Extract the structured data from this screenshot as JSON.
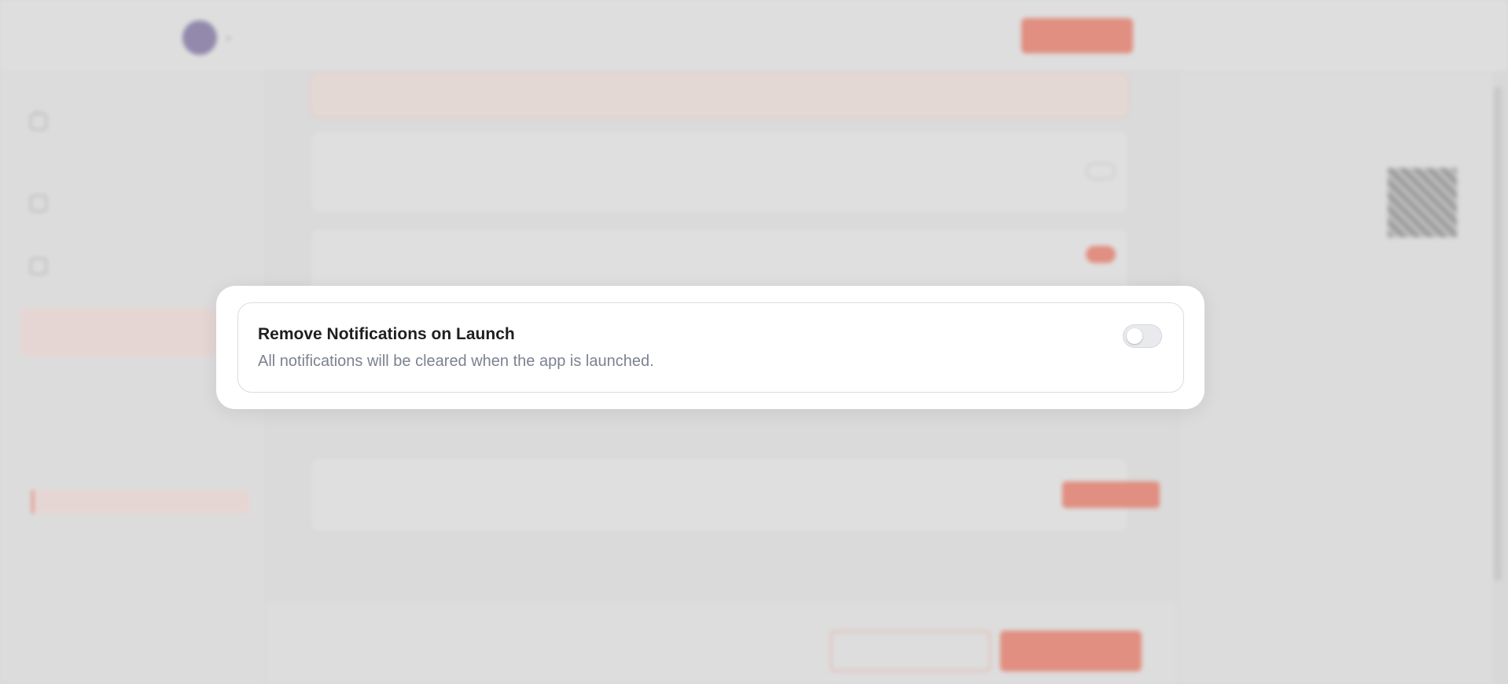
{
  "colors": {
    "accent": "#e8543a",
    "modal_bg": "#ffffff",
    "toggle_off_bg": "#e9eaee",
    "description_text": "#7b8290",
    "backdrop": "#d8d8d8"
  },
  "modal": {
    "setting": {
      "title": "Remove Notifications on Launch",
      "description": "All notifications will be cleared when the app is launched.",
      "toggle_enabled": false
    }
  }
}
